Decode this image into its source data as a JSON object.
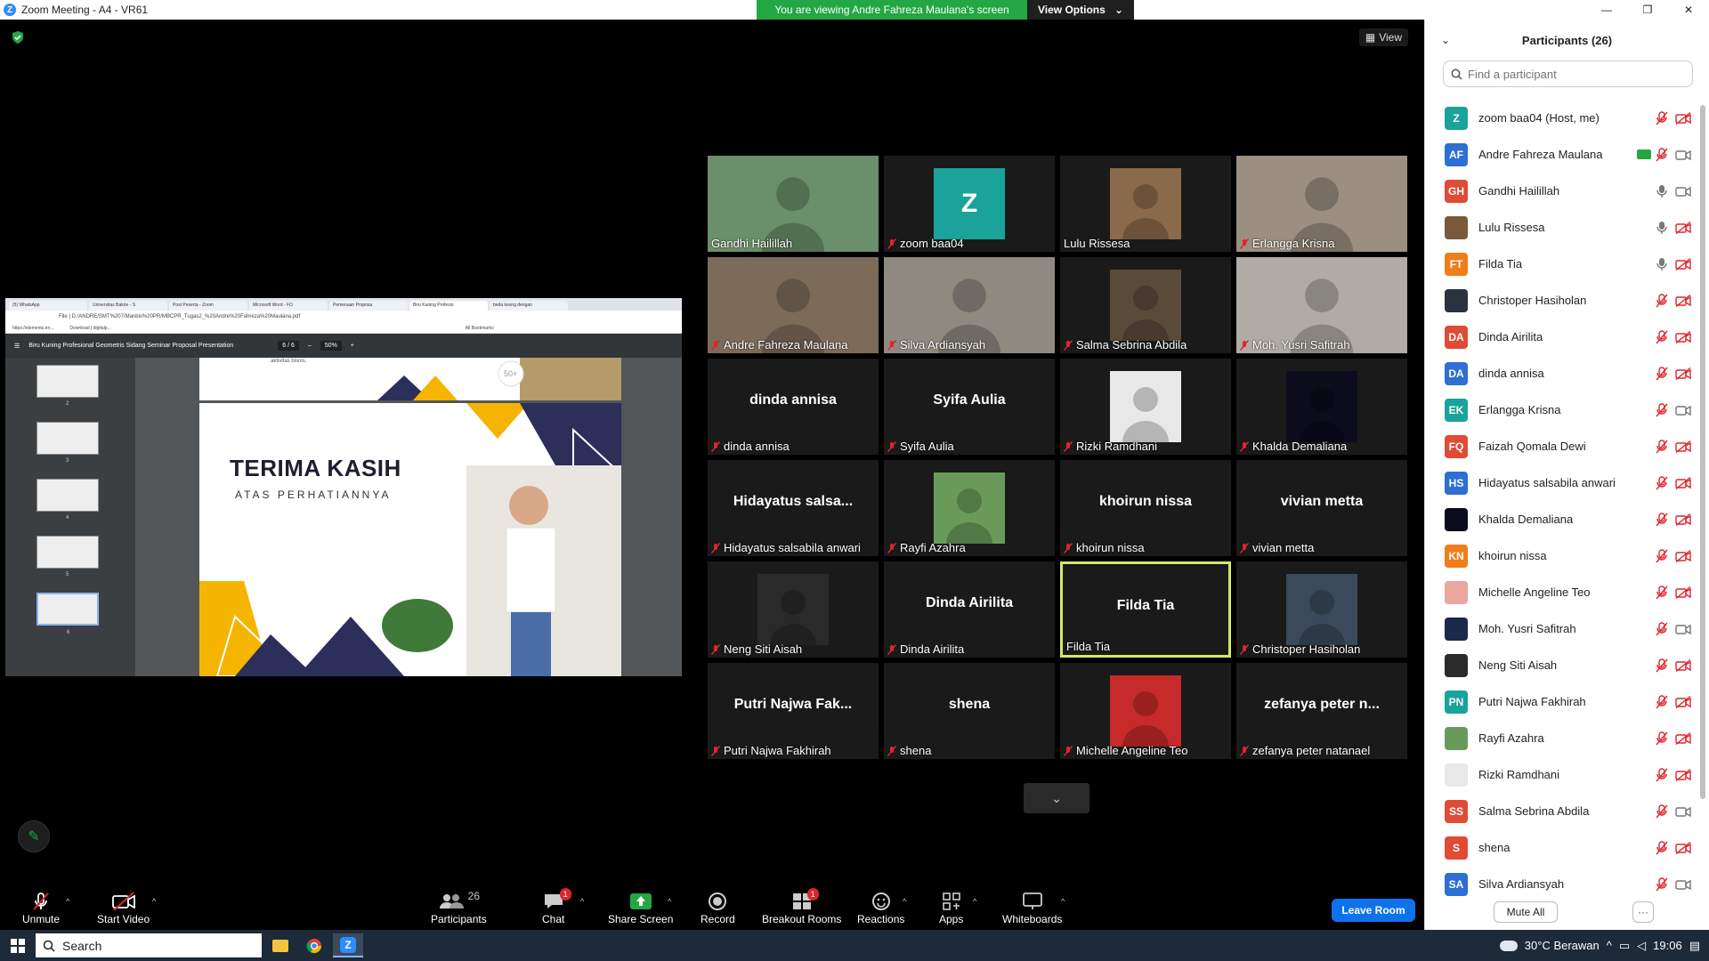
{
  "window": {
    "title": "Zoom Meeting - A4 - VR61",
    "minimize": "—",
    "maximize": "❐",
    "close": "✕"
  },
  "banner": {
    "message": "You are viewing Andre Fahreza Maulana's screen",
    "options": "View Options"
  },
  "view_button": "View",
  "shared_screen": {
    "tabs": [
      "(5) WhatsApp",
      "Universitas Bakrie - S",
      "Post Peserta - Zoom",
      "Microsoft Word - FO",
      "Pemenaan Proposa",
      "Biru Kuning Profesio",
      "beda kesng dengan"
    ],
    "address": "File | D:/ANDRE/SMT%207/Manbis%20PR/MBCPR_Tugas2_%20Andre%20Fahreza%20Maulana.pdf",
    "bookmarks": [
      "https://elements.en...",
      "Download | digitalp...",
      "All Bookmarks"
    ],
    "pdf_title": "Biru Kuning Profesional Geometris Sidang Seminar Proposal Presentation",
    "page_indicator": "6 / 6",
    "zoom": "50%",
    "thumb_numbers": [
      "2",
      "3",
      "4",
      "5",
      "6"
    ],
    "page1_text": "aktivitas bisnis.",
    "page1_badge": "50+",
    "slide_title": "TERIMA KASIH",
    "slide_subtitle": "ATAS PERHATIANNYA"
  },
  "tiles": [
    {
      "name": "Gandhi Hailillah",
      "big": "",
      "muted": false,
      "photo": "#6b8f6a"
    },
    {
      "name": "zoom baa04",
      "big": "",
      "muted": true,
      "avatar": "Z"
    },
    {
      "name": "Lulu Rissesa",
      "big": "",
      "muted": false,
      "photo": "#8a6a4a"
    },
    {
      "name": "Erlangga Krisna",
      "big": "",
      "muted": true,
      "photo": "#9a8f80"
    },
    {
      "name": "Andre Fahreza Maulana",
      "big": "",
      "muted": true,
      "photo": "#7d6b5a"
    },
    {
      "name": "Silva Ardiansyah",
      "big": "",
      "muted": true,
      "photo": "#8f8a80"
    },
    {
      "name": "Salma Sebrina Abdila",
      "big": "",
      "muted": true,
      "photo": "#5a4a3a"
    },
    {
      "name": "Moh. Yusri Safitrah",
      "big": "",
      "muted": true,
      "photo": "#b0aca5"
    },
    {
      "name": "dinda annisa",
      "big": "dinda annisa",
      "muted": true
    },
    {
      "name": "Syifa Aulia",
      "big": "Syifa Aulia",
      "muted": true
    },
    {
      "name": "Rizki Ramdhani",
      "big": "",
      "muted": true,
      "photo": "#e8e8e8"
    },
    {
      "name": "Khalda Demaliana",
      "big": "",
      "muted": true,
      "photo": "#0c0c1c"
    },
    {
      "name": "Hidayatus salsabila anwari",
      "big": "Hidayatus salsa...",
      "muted": true
    },
    {
      "name": "Rayfi Azahra",
      "big": "",
      "muted": true,
      "photo": "#6a9a5a"
    },
    {
      "name": "khoirun nissa",
      "big": "khoirun nissa",
      "muted": true
    },
    {
      "name": "vivian metta",
      "big": "vivian metta",
      "muted": true
    },
    {
      "name": "Neng Siti Aisah",
      "big": "",
      "muted": true,
      "photo": "#2a2a2a"
    },
    {
      "name": "Dinda Airilita",
      "big": "Dinda Airilita",
      "muted": true
    },
    {
      "name": "Filda Tia",
      "big": "Filda Tia",
      "muted": false,
      "active": true
    },
    {
      "name": "Christoper Hasiholan",
      "big": "",
      "muted": true,
      "photo": "#3a4a5a"
    },
    {
      "name": "Putri Najwa Fakhirah",
      "big": "Putri Najwa Fak...",
      "muted": true
    },
    {
      "name": "shena",
      "big": "shena",
      "muted": true
    },
    {
      "name": "Michelle Angeline Teo",
      "big": "",
      "muted": true,
      "photo": "#c62a2a"
    },
    {
      "name": "zefanya peter natanael",
      "big": "zefanya peter n...",
      "muted": true
    }
  ],
  "toolbar": {
    "unmute": "Unmute",
    "start_video": "Start Video",
    "participants": "Participants",
    "participants_count": "26",
    "chat": "Chat",
    "chat_badge": "1",
    "share_screen": "Share Screen",
    "record": "Record",
    "breakout_rooms": "Breakout Rooms",
    "breakout_badge": "1",
    "reactions": "Reactions",
    "apps": "Apps",
    "whiteboards": "Whiteboards",
    "leave_room": "Leave Room"
  },
  "panel": {
    "title": "Participants (26)",
    "search_placeholder": "Find a participant",
    "participants": [
      {
        "name": "zoom baa04 (Host, me)",
        "initials": "Z",
        "color": "#1aa39a",
        "mic": "muted",
        "cam": "off"
      },
      {
        "name": "Andre Fahreza Maulana",
        "initials": "AF",
        "color": "#2d6fd2",
        "mic": "muted",
        "cam": "on",
        "sharing": true
      },
      {
        "name": "Gandhi Hailillah",
        "initials": "GH",
        "color": "#e04b35",
        "mic": "on",
        "cam": "on"
      },
      {
        "name": "Lulu Rissesa",
        "initials": "",
        "color": "#7a5a3a",
        "mic": "on",
        "cam": "off"
      },
      {
        "name": "Filda Tia",
        "initials": "FT",
        "color": "#f07c1a",
        "mic": "on",
        "cam": "off"
      },
      {
        "name": "Christoper Hasiholan",
        "initials": "",
        "color": "#2a3240",
        "mic": "muted",
        "cam": "off"
      },
      {
        "name": "Dinda Airilita",
        "initials": "DA",
        "color": "#e04b35",
        "mic": "muted",
        "cam": "off"
      },
      {
        "name": "dinda annisa",
        "initials": "DA",
        "color": "#2d6fd2",
        "mic": "muted",
        "cam": "off"
      },
      {
        "name": "Erlangga Krisna",
        "initials": "EK",
        "color": "#1aa39a",
        "mic": "muted",
        "cam": "on"
      },
      {
        "name": "Faizah Qomala Dewi",
        "initials": "FQ",
        "color": "#e04b35",
        "mic": "muted",
        "cam": "off"
      },
      {
        "name": "Hidayatus salsabila anwari",
        "initials": "HS",
        "color": "#2d6fd2",
        "mic": "muted",
        "cam": "off"
      },
      {
        "name": "Khalda Demaliana",
        "initials": "",
        "color": "#0c0c1c",
        "mic": "muted",
        "cam": "off"
      },
      {
        "name": "khoirun nissa",
        "initials": "KN",
        "color": "#f07c1a",
        "mic": "muted",
        "cam": "off"
      },
      {
        "name": "Michelle Angeline Teo",
        "initials": "",
        "color": "#e8a8a0",
        "mic": "muted",
        "cam": "off"
      },
      {
        "name": "Moh. Yusri Safitrah",
        "initials": "",
        "color": "#1a2a4a",
        "mic": "muted",
        "cam": "on"
      },
      {
        "name": "Neng Siti Aisah",
        "initials": "",
        "color": "#2a2a2a",
        "mic": "muted",
        "cam": "off"
      },
      {
        "name": "Putri Najwa Fakhirah",
        "initials": "PN",
        "color": "#1aa39a",
        "mic": "muted",
        "cam": "off"
      },
      {
        "name": "Rayfi Azahra",
        "initials": "",
        "color": "#6a9a5a",
        "mic": "muted",
        "cam": "off"
      },
      {
        "name": "Rizki Ramdhani",
        "initials": "",
        "color": "#e8e8e8",
        "mic": "muted",
        "cam": "off"
      },
      {
        "name": "Salma Sebrina Abdila",
        "initials": "SS",
        "color": "#e04b35",
        "mic": "muted",
        "cam": "on"
      },
      {
        "name": "shena",
        "initials": "S",
        "color": "#e04b35",
        "mic": "muted",
        "cam": "off"
      },
      {
        "name": "Silva Ardiansyah",
        "initials": "SA",
        "color": "#2d6fd2",
        "mic": "muted",
        "cam": "on"
      }
    ],
    "mute_all": "Mute All",
    "more": "···"
  },
  "taskbar": {
    "search": "Search",
    "weather": "30°C  Berawan",
    "time": "19:06"
  },
  "colors": {
    "zoom_blue": "#0e72ed",
    "banner_green": "#23a744",
    "muted_red": "#e0242c",
    "active_speaker": "#d4e86a"
  }
}
